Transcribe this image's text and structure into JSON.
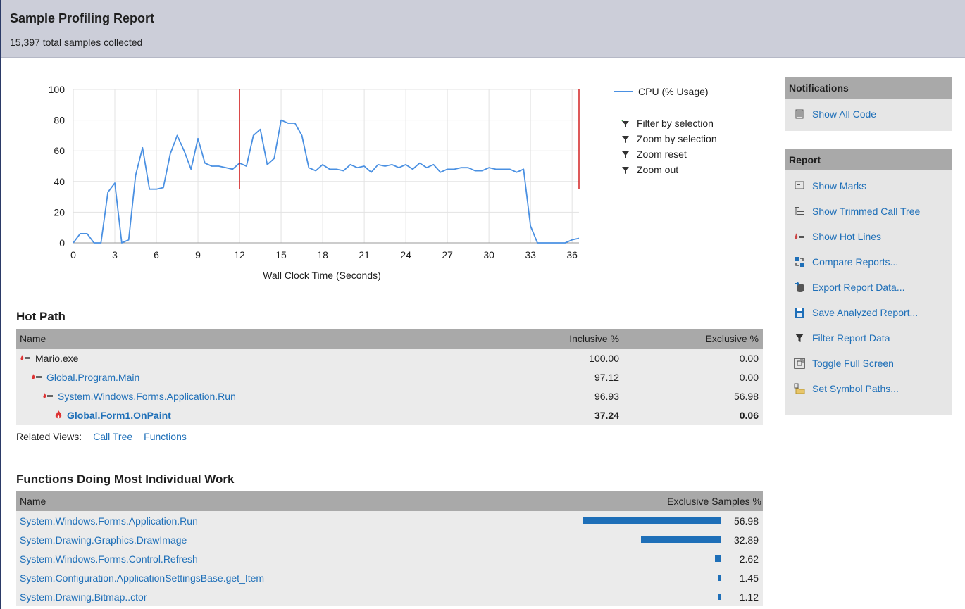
{
  "header": {
    "title": "Sample Profiling Report",
    "subtitle": "15,397 total samples collected"
  },
  "chart_data": {
    "type": "line",
    "xlabel": "Wall Clock Time (Seconds)",
    "ylabel": "",
    "xlim": [
      0,
      36.5
    ],
    "ylim": [
      0,
      100
    ],
    "xticks": [
      "0",
      "3",
      "6",
      "9",
      "12",
      "15",
      "18",
      "21",
      "24",
      "27",
      "30",
      "33",
      "36"
    ],
    "yticks": [
      "0",
      "20",
      "40",
      "60",
      "80",
      "100"
    ],
    "grid": true,
    "legend": "right",
    "series": [
      {
        "name": "CPU (% Usage)",
        "color": "#4a90e2",
        "x": [
          0,
          0.5,
          1,
          1.5,
          2,
          2.5,
          3,
          3.5,
          4,
          4.5,
          5,
          5.5,
          6,
          6.5,
          7,
          7.5,
          8,
          8.5,
          9,
          9.5,
          10,
          10.5,
          11,
          11.5,
          12,
          12.5,
          13,
          13.5,
          14,
          14.5,
          15,
          15.5,
          16,
          16.5,
          17,
          17.5,
          18,
          18.5,
          19,
          19.5,
          20,
          20.5,
          21,
          21.5,
          22,
          22.5,
          23,
          23.5,
          24,
          24.5,
          25,
          25.5,
          26,
          26.5,
          27,
          27.5,
          28,
          28.5,
          29,
          29.5,
          30,
          30.5,
          31,
          31.5,
          32,
          32.5,
          33,
          33.5,
          34,
          34.5,
          35,
          35.5,
          36,
          36.5
        ],
        "values": [
          0,
          6,
          6,
          0,
          0,
          33,
          39,
          0,
          2,
          44,
          62,
          35,
          35,
          36,
          58,
          70,
          60,
          48,
          68,
          52,
          50,
          50,
          49,
          48,
          52,
          50,
          70,
          74,
          51,
          55,
          80,
          78,
          78,
          70,
          49,
          47,
          51,
          48,
          48,
          47,
          51,
          49,
          50,
          46,
          51,
          50,
          51,
          49,
          51,
          48,
          52,
          49,
          51,
          46,
          48,
          48,
          49,
          49,
          47,
          47,
          49,
          48,
          48,
          48,
          46,
          48,
          11,
          0,
          0,
          0,
          0,
          0,
          2,
          3
        ]
      }
    ],
    "markers": [
      12,
      36.5
    ],
    "marker_color": "#cc0000"
  },
  "legend": {
    "series_label": "CPU (% Usage)",
    "filter_by_selection": "Filter by selection",
    "zoom_by_selection": "Zoom by selection",
    "zoom_reset": "Zoom reset",
    "zoom_out": "Zoom out"
  },
  "hot_path": {
    "title": "Hot Path",
    "columns": [
      "Name",
      "Inclusive %",
      "Exclusive %"
    ],
    "rows": [
      {
        "name": "Mario.exe",
        "inclusive": "100.00",
        "exclusive": "0.00",
        "indent": 0,
        "link": false,
        "bold": false
      },
      {
        "name": "Global.Program.Main",
        "inclusive": "97.12",
        "exclusive": "0.00",
        "indent": 1,
        "link": true,
        "bold": false
      },
      {
        "name": "System.Windows.Forms.Application.Run",
        "inclusive": "96.93",
        "exclusive": "56.98",
        "indent": 2,
        "link": true,
        "bold": false
      },
      {
        "name": "Global.Form1.OnPaint",
        "inclusive": "37.24",
        "exclusive": "0.06",
        "indent": 3,
        "link": true,
        "bold": true
      }
    ],
    "related_label": "Related Views:",
    "related_links": [
      "Call Tree",
      "Functions"
    ]
  },
  "functions": {
    "title": "Functions Doing Most Individual Work",
    "columns": [
      "Name",
      "Exclusive Samples %"
    ],
    "rows": [
      {
        "name": "System.Windows.Forms.Application.Run",
        "value": "56.98",
        "fraction": 0.5698
      },
      {
        "name": "System.Drawing.Graphics.DrawImage",
        "value": "32.89",
        "fraction": 0.3289
      },
      {
        "name": "System.Windows.Forms.Control.Refresh",
        "value": "2.62",
        "fraction": 0.0262
      },
      {
        "name": "System.Configuration.ApplicationSettingsBase.get_Item",
        "value": "1.45",
        "fraction": 0.0145
      },
      {
        "name": "System.Drawing.Bitmap..ctor",
        "value": "1.12",
        "fraction": 0.0112
      }
    ]
  },
  "notifications": {
    "title": "Notifications",
    "items": [
      {
        "label": "Show All Code",
        "icon": "code-page-icon"
      }
    ]
  },
  "report": {
    "title": "Report",
    "items": [
      {
        "label": "Show Marks",
        "icon": "marks-icon"
      },
      {
        "label": "Show Trimmed Call Tree",
        "icon": "call-tree-icon"
      },
      {
        "label": "Show Hot Lines",
        "icon": "hot-lines-icon"
      },
      {
        "label": "Compare Reports...",
        "icon": "compare-icon"
      },
      {
        "label": "Export Report Data...",
        "icon": "export-icon"
      },
      {
        "label": "Save Analyzed Report...",
        "icon": "save-icon"
      },
      {
        "label": "Filter Report Data",
        "icon": "filter-icon"
      },
      {
        "label": "Toggle Full Screen",
        "icon": "full-screen-icon"
      },
      {
        "label": "Set Symbol Paths...",
        "icon": "folder-icon"
      }
    ]
  }
}
